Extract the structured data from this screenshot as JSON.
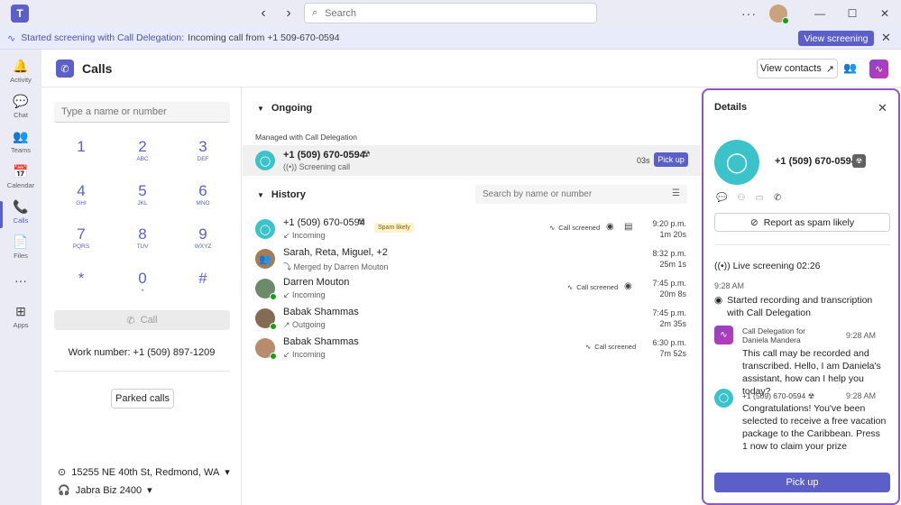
{
  "titlebar": {
    "search_placeholder": "Search",
    "back_icon": "chevron-left-icon",
    "forward_icon": "chevron-right-icon",
    "more_glyph": "···",
    "minimize_glyph": "—",
    "maximize_glyph": "☐",
    "close_glyph": "✕"
  },
  "banner": {
    "title": "Started screening with Call Delegation:",
    "text": "Incoming call from +1 509-670-0594",
    "button": "View screening",
    "close_glyph": "✕"
  },
  "rail": {
    "items": [
      {
        "label": "Activity",
        "icon": "bell-icon",
        "glyph": "🔔"
      },
      {
        "label": "Chat",
        "icon": "chat-icon",
        "glyph": "💬"
      },
      {
        "label": "Teams",
        "icon": "teams-icon",
        "glyph": "👥"
      },
      {
        "label": "Calendar",
        "icon": "calendar-icon",
        "glyph": "📅"
      },
      {
        "label": "Calls",
        "icon": "phone-icon",
        "glyph": "📞"
      },
      {
        "label": "Files",
        "icon": "file-icon",
        "glyph": "📄"
      },
      {
        "label": "",
        "icon": "more-icon",
        "glyph": "···"
      },
      {
        "label": "Apps",
        "icon": "apps-icon",
        "glyph": "⊞"
      }
    ]
  },
  "header": {
    "title": "Calls",
    "view_contacts": "View contacts"
  },
  "dialpad": {
    "input_placeholder": "Type a name or number",
    "keys": [
      {
        "d": "1",
        "l": ""
      },
      {
        "d": "2",
        "l": "ABC"
      },
      {
        "d": "3",
        "l": "DEF"
      },
      {
        "d": "4",
        "l": "GHI"
      },
      {
        "d": "5",
        "l": "JKL"
      },
      {
        "d": "6",
        "l": "MNO"
      },
      {
        "d": "7",
        "l": "PQRS"
      },
      {
        "d": "8",
        "l": "TUV"
      },
      {
        "d": "9",
        "l": "WXYZ"
      },
      {
        "d": "*",
        "l": ""
      },
      {
        "d": "0",
        "l": "+"
      },
      {
        "d": "#",
        "l": ""
      }
    ],
    "call_label": "Call",
    "work_number": "Work number: +1 (509) 897-1209",
    "parked_calls": "Parked calls",
    "location": "15255 NE 40th St, Redmond, WA",
    "device": "Jabra Biz 2400"
  },
  "ongoing": {
    "heading": "Ongoing",
    "managed_label": "Managed with Call Delegation",
    "number": "+1 (509) 670-0594",
    "status": "Screening call",
    "duration": "03s",
    "pickup": "Pick up"
  },
  "history": {
    "heading": "History",
    "search_placeholder": "Search by name or number",
    "rows": [
      {
        "name": "+1 (509) 670-0594",
        "sub": "Incoming",
        "badge": "Spam likely",
        "screened": "Call screened",
        "time": "9:20 p.m.",
        "dur": "1m 20s"
      },
      {
        "name": "Sarah, Reta, Miguel, +2",
        "sub": "Merged by Darren Mouton",
        "badge": "",
        "screened": "",
        "time": "8:32 p.m.",
        "dur": "25m 1s"
      },
      {
        "name": "Darren Mouton",
        "sub": "Incoming",
        "badge": "",
        "screened": "Call screened",
        "time": "7:45 p.m.",
        "dur": "20m 8s"
      },
      {
        "name": "Babak Shammas",
        "sub": "Outgoing",
        "badge": "",
        "screened": "",
        "time": "7:45 p.m.",
        "dur": "2m 35s"
      },
      {
        "name": "Babak Shammas",
        "sub": "Incoming",
        "badge": "",
        "screened": "Call screened",
        "time": "6:30 p.m.",
        "dur": "7m 52s"
      }
    ]
  },
  "details": {
    "title": "Details",
    "number": "+1 (509) 670-0594",
    "report_spam": "Report as spam likely",
    "live": "Live screening 02:26",
    "t1": "9:28 AM",
    "started": "Started recording and transcription with Call Delegation",
    "m1_from": "Call Delegation for Daniela Mandera",
    "m1_time": "9:28 AM",
    "m1_text": "This call may be recorded and transcribed. Hello, I am Daniela's assistant, how can I help you today?",
    "m2_from": "+1 (509) 670-0594",
    "m2_time": "9:28 AM",
    "m2_text": "Congratulations! You've been selected to receive a free vacation package to the Caribbean. Press 1 now to claim your prize",
    "pickup": "Pick up"
  },
  "colors": {
    "accent": "#5b5fc7",
    "delegation": "#c239b3",
    "caller_avatar": "#3cc3c9"
  }
}
